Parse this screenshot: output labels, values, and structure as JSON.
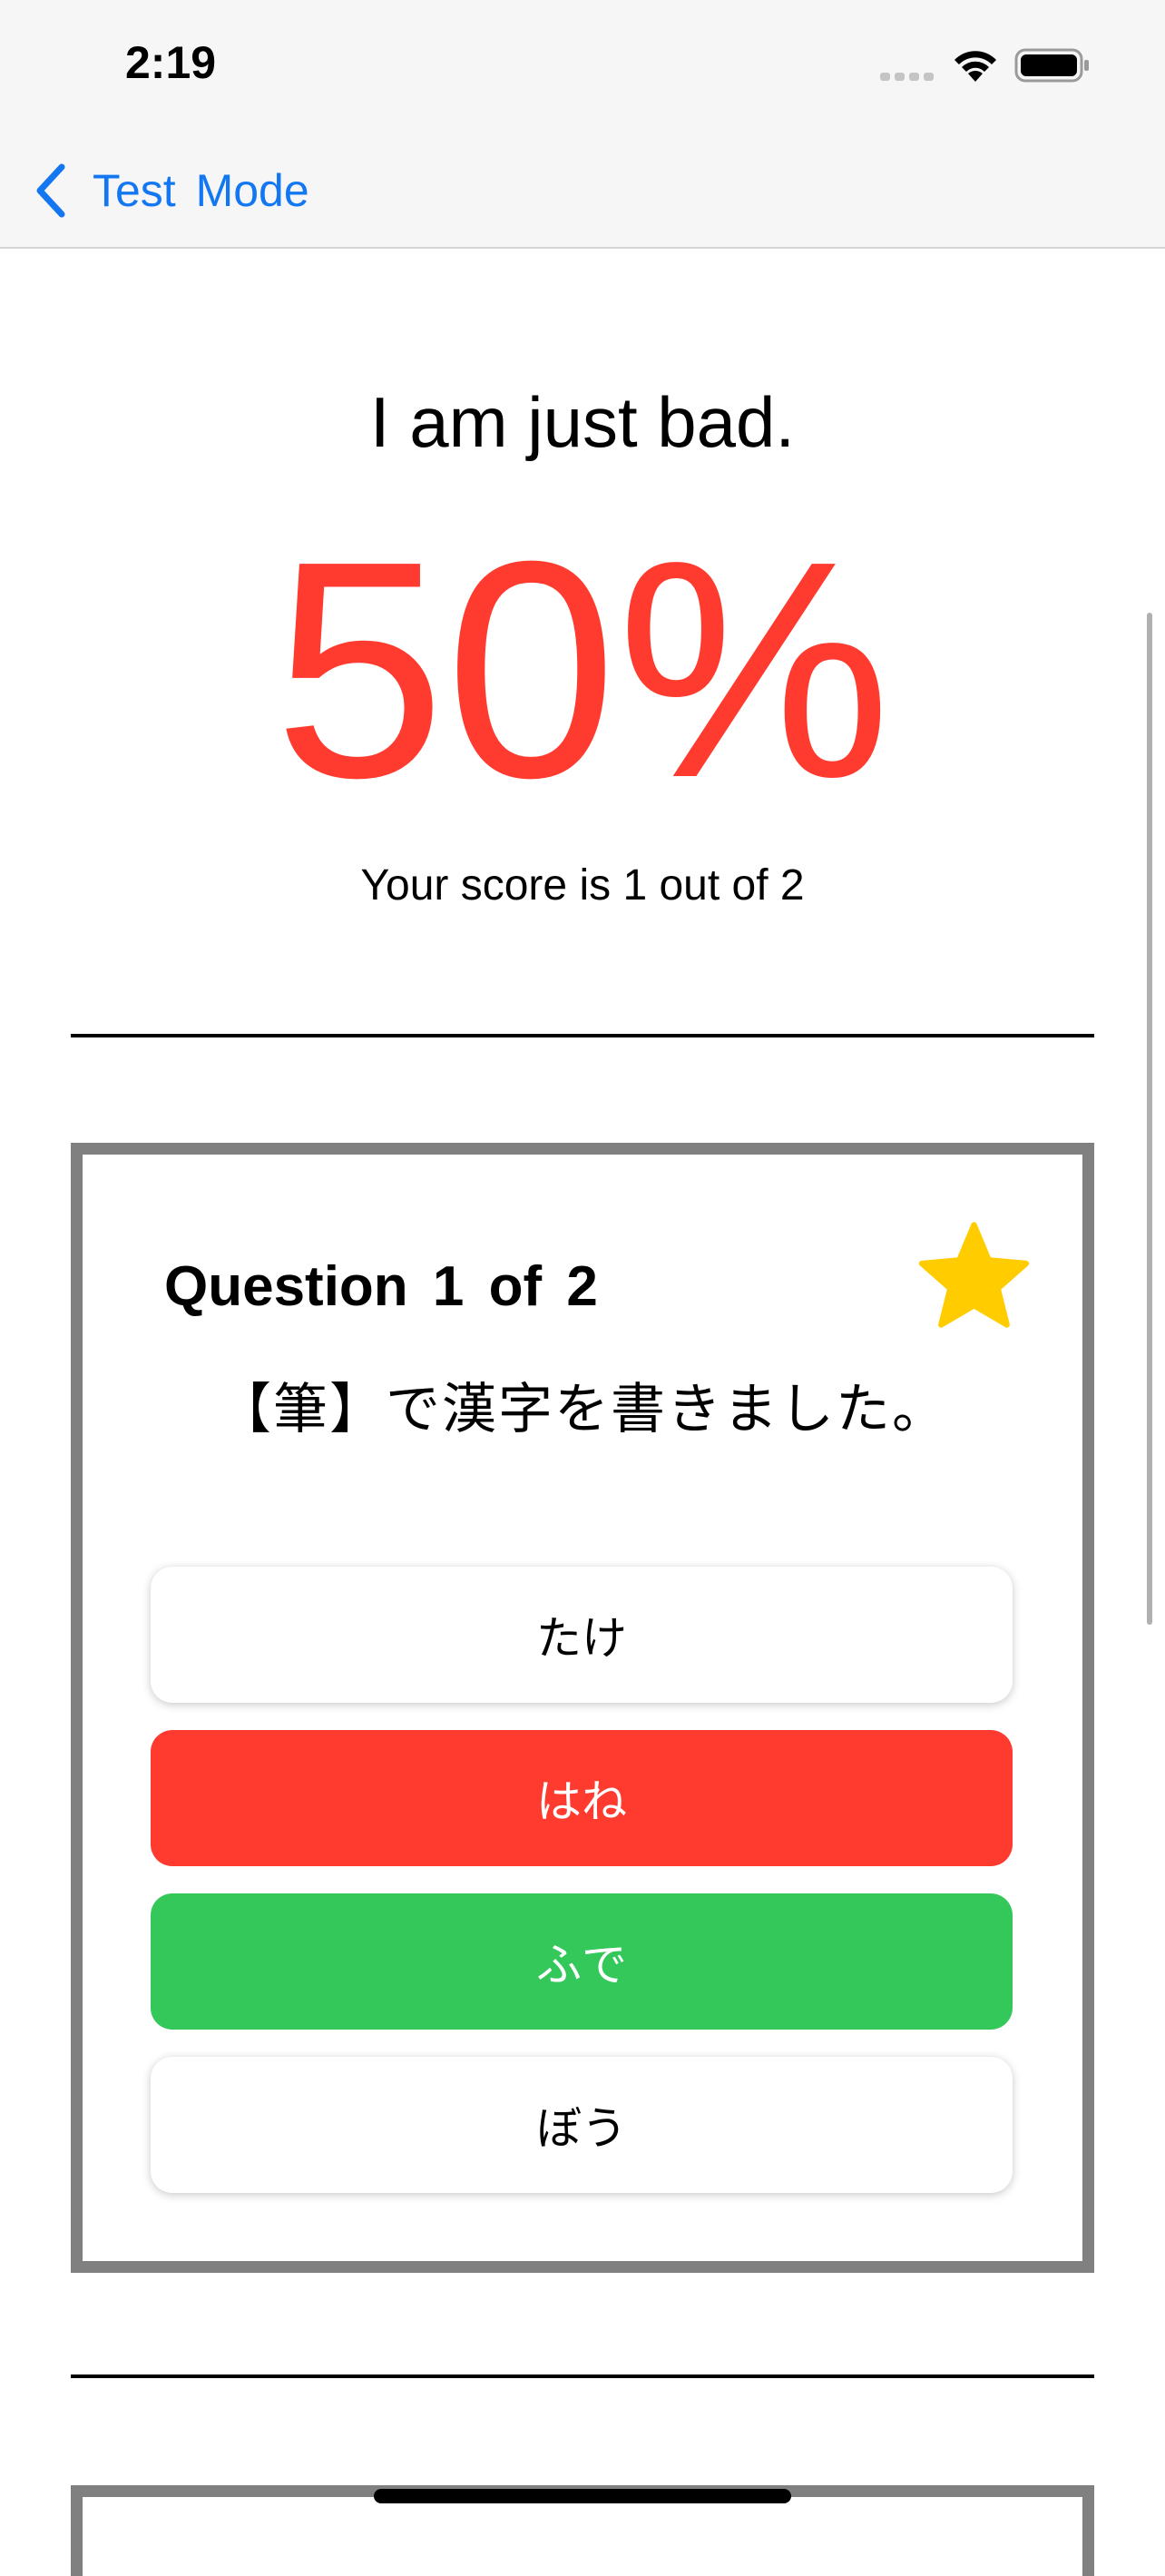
{
  "status_bar": {
    "time": "2:19"
  },
  "nav": {
    "back_label": "Test  Mode"
  },
  "result": {
    "title": "I am just bad.",
    "percent": "50%",
    "score_text": "Your score is 1 out of 2",
    "percent_color": "#ff3b30"
  },
  "question": {
    "header": "Question  1  of  2",
    "text": "【筆】で漢字を書きました。",
    "starred": true,
    "answers": [
      {
        "label": "たけ",
        "state": "neutral"
      },
      {
        "label": "はね",
        "state": "wrong"
      },
      {
        "label": "ふで",
        "state": "correct"
      },
      {
        "label": "ぼう",
        "state": "neutral"
      }
    ]
  },
  "colors": {
    "accent": "#1477f2",
    "wrong": "#ff3b30",
    "correct": "#34c759",
    "star": "#ffcc00",
    "card_border": "#808080"
  }
}
